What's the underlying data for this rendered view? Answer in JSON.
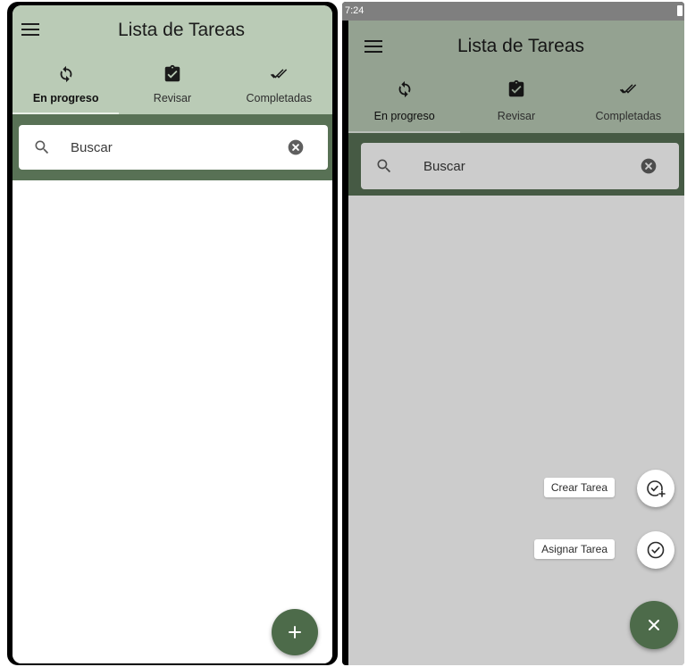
{
  "app": {
    "title": "Lista de Tareas"
  },
  "status_bar": {
    "time": "7:24"
  },
  "tabs": [
    {
      "label": "En progreso",
      "icon": "sync-icon",
      "active": true
    },
    {
      "label": "Revisar",
      "icon": "clipboard-check-icon",
      "active": false
    },
    {
      "label": "Completadas",
      "icon": "double-check-icon",
      "active": false
    }
  ],
  "search": {
    "placeholder": "Buscar"
  },
  "speed_dial": {
    "create_label": "Crear Tarea",
    "assign_label": "Asignar Tarea"
  },
  "colors": {
    "appbar": "#bacbb6",
    "search_band": "#587155",
    "fab": "#4d6b4a"
  }
}
